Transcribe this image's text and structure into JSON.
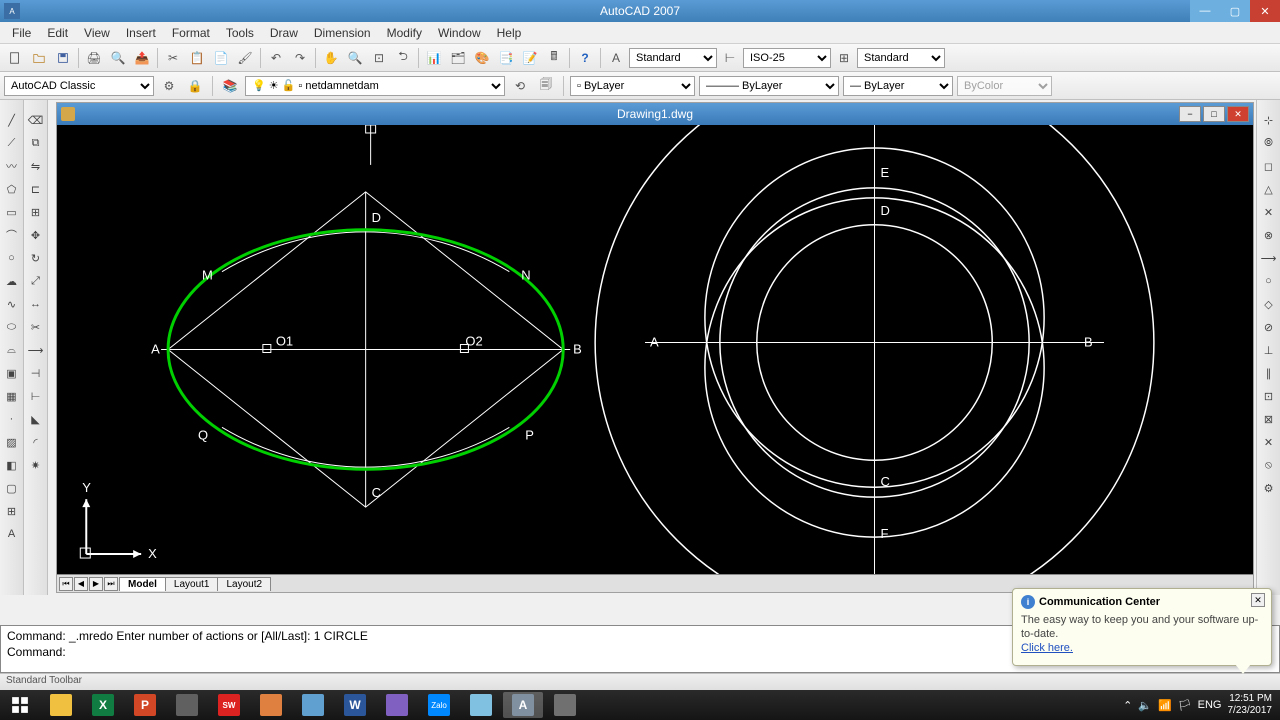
{
  "app": {
    "title": "AutoCAD 2007"
  },
  "menu": [
    "File",
    "Edit",
    "View",
    "Insert",
    "Format",
    "Tools",
    "Draw",
    "Dimension",
    "Modify",
    "Window",
    "Help"
  ],
  "toolbar": {
    "text_style": "Standard",
    "dim_style": "ISO-25",
    "table_style": "Standard"
  },
  "toolbar2": {
    "workspace": "AutoCAD Classic",
    "layer": "netdam",
    "linetype": "ByLayer",
    "lineweight": "ByLayer",
    "color": "ByColor"
  },
  "drawing": {
    "title": "Drawing1.dwg"
  },
  "labels_left": {
    "A": "A",
    "B": "B",
    "C": "C",
    "D": "D",
    "M": "M",
    "N": "N",
    "P": "P",
    "Q": "Q",
    "O1": "O1",
    "O2": "O2"
  },
  "labels_right": {
    "A": "A",
    "B": "B",
    "C": "C",
    "D": "D",
    "E": "E",
    "F": "F"
  },
  "ucs": {
    "x": "X",
    "y": "Y"
  },
  "tabs": {
    "model": "Model",
    "layout1": "Layout1",
    "layout2": "Layout2"
  },
  "command": {
    "line1": "Command: _.mredo Enter number of actions or [All/Last]: 1 CIRCLE",
    "line2": "Command:"
  },
  "status": {
    "text": "Standard Toolbar"
  },
  "commcenter": {
    "title": "Communication Center",
    "body": "The easy way to keep you and your software up-to-date.",
    "link": "Click here."
  },
  "systray": {
    "lang": "ENG",
    "time": "12:51 PM",
    "date": "7/23/2017"
  }
}
